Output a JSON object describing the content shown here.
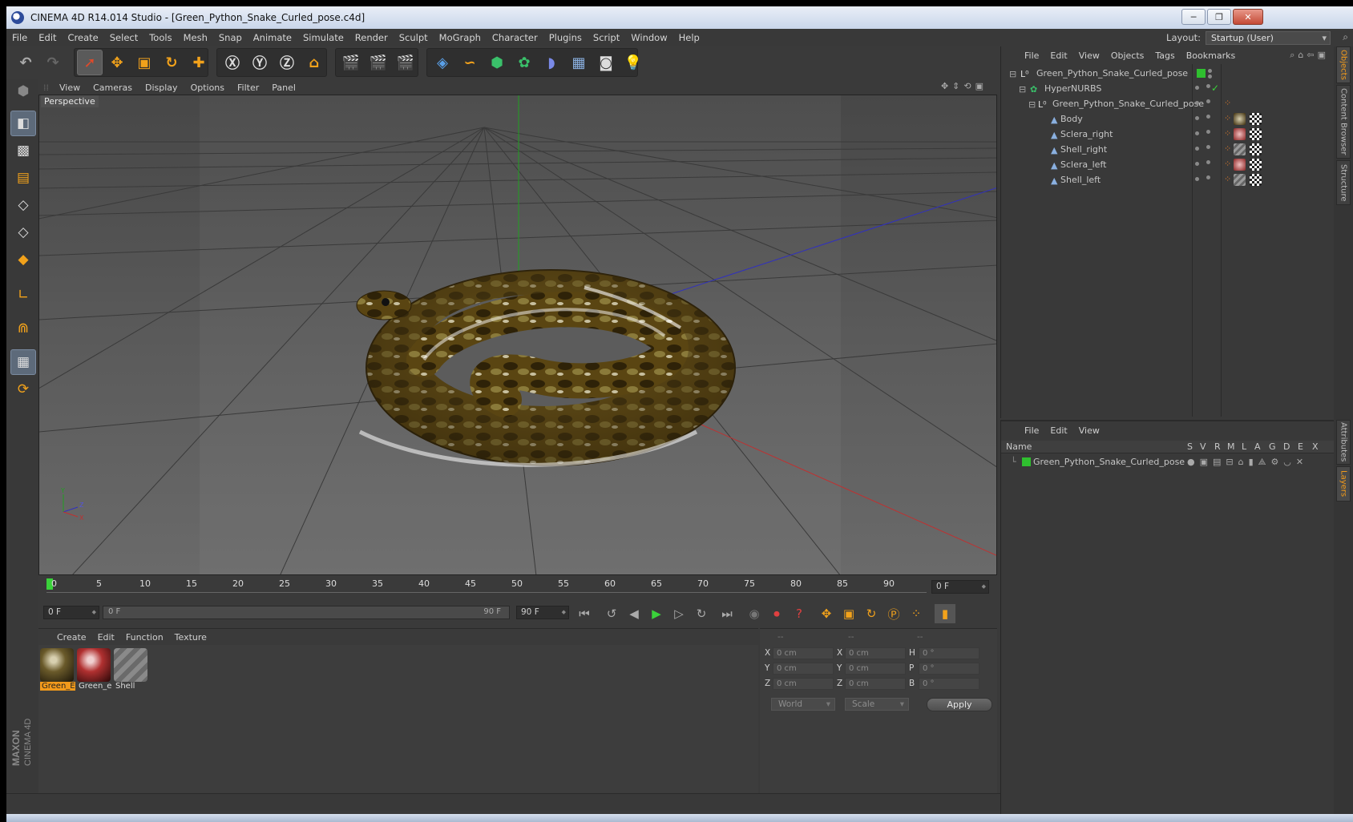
{
  "window": {
    "title": "CINEMA 4D R14.014 Studio - [Green_Python_Snake_Curled_pose.c4d]",
    "minimize": "─",
    "maximize": "❐",
    "close": "✕"
  },
  "menubar": [
    "File",
    "Edit",
    "Create",
    "Select",
    "Tools",
    "Mesh",
    "Snap",
    "Animate",
    "Simulate",
    "Render",
    "Sculpt",
    "MoGraph",
    "Character",
    "Plugins",
    "Script",
    "Window",
    "Help"
  ],
  "layout": {
    "label": "Layout:",
    "value": "Startup (User)"
  },
  "viewport": {
    "menu": [
      "View",
      "Cameras",
      "Display",
      "Options",
      "Filter",
      "Panel"
    ],
    "label": "Perspective"
  },
  "timeline": {
    "ticks": [
      "0",
      "5",
      "10",
      "15",
      "20",
      "25",
      "30",
      "35",
      "40",
      "45",
      "50",
      "55",
      "60",
      "65",
      "70",
      "75",
      "80",
      "85",
      "90"
    ],
    "current_frame": "0 F",
    "start_field": "0 F",
    "range_start": "0 F",
    "range_end": "90 F",
    "end_field": "90 F"
  },
  "material_panel": {
    "menu": [
      "Create",
      "Edit",
      "Function",
      "Texture"
    ],
    "materials": [
      {
        "label": "Green_E"
      },
      {
        "label": "Green_e"
      },
      {
        "label": "Shell"
      }
    ]
  },
  "coordinates": {
    "headers": [
      "--",
      "--",
      "--"
    ],
    "rows": [
      {
        "l1": "X",
        "v1": "0 cm",
        "l2": "X",
        "v2": "0 cm",
        "l3": "H",
        "v3": "0 °"
      },
      {
        "l1": "Y",
        "v1": "0 cm",
        "l2": "Y",
        "v2": "0 cm",
        "l3": "P",
        "v3": "0 °"
      },
      {
        "l1": "Z",
        "v1": "0 cm",
        "l2": "Z",
        "v2": "0 cm",
        "l3": "B",
        "v3": "0 °"
      }
    ],
    "space": "World",
    "mode": "Scale",
    "apply": "Apply"
  },
  "object_manager": {
    "menu": [
      "File",
      "Edit",
      "View",
      "Objects",
      "Tags",
      "Bookmarks"
    ],
    "objects": [
      {
        "name": "Green_Python_Snake_Curled_pose"
      },
      {
        "name": "HyperNURBS"
      },
      {
        "name": "Green_Python_Snake_Curled_pose"
      },
      {
        "name": "Body"
      },
      {
        "name": "Sclera_right"
      },
      {
        "name": "Shell_right"
      },
      {
        "name": "Sclera_left"
      },
      {
        "name": "Shell_left"
      }
    ]
  },
  "layer_manager": {
    "menu": [
      "File",
      "Edit",
      "View"
    ],
    "columns": [
      "Name",
      "S",
      "V",
      "R",
      "M",
      "L",
      "A",
      "G",
      "D",
      "E",
      "X"
    ],
    "layers": [
      {
        "name": "Green_Python_Snake_Curled_pose",
        "color": "#2fbf2f"
      }
    ]
  },
  "right_tabs": [
    "Objects",
    "Content Browser",
    "Structure",
    "Attributes",
    "Layers"
  ],
  "brand": {
    "maxon": "MAXON",
    "cinema": "CINEMA 4D"
  },
  "colors": {
    "accent": "#f29a1b",
    "grid": "#3a3a3a",
    "axis_x": "#c03030",
    "axis_y": "#20a020",
    "axis_z": "#3030c0"
  }
}
